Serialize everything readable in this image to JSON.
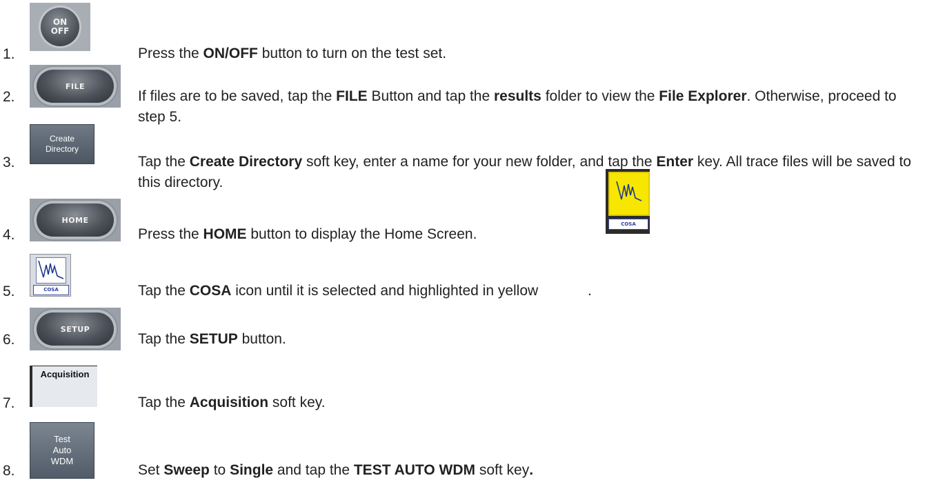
{
  "steps": [
    {
      "number": "1.",
      "icon": {
        "name": "onoff-button-icon",
        "lines": [
          "ON",
          "OFF"
        ]
      },
      "parts": [
        {
          "t": "Press the "
        },
        {
          "t": "ON/OFF",
          "b": true
        },
        {
          "t": " button to turn on the test set."
        }
      ]
    },
    {
      "number": "2.",
      "icon": {
        "name": "file-button-icon",
        "label": "FILE"
      },
      "parts": [
        {
          "t": "If files are to be saved, tap the "
        },
        {
          "t": "FILE",
          "b": true
        },
        {
          "t": " Button and tap the "
        },
        {
          "t": "results",
          "b": true
        },
        {
          "t": " folder to view the "
        },
        {
          "t": "File Explorer",
          "b": true
        },
        {
          "t": ".  Otherwise, proceed to step 5."
        }
      ]
    },
    {
      "number": "3.",
      "icon": {
        "name": "create-directory-softkey-icon",
        "lines": [
          "Create",
          "Directory"
        ]
      },
      "parts": [
        {
          "t": "Tap the "
        },
        {
          "t": "Create Directory",
          "b": true
        },
        {
          "t": " soft key, enter a name for your new folder, and tap the "
        },
        {
          "t": "Enter",
          "b": true
        },
        {
          "t": " key.  All trace files will be saved to this directory."
        }
      ]
    },
    {
      "number": "4.",
      "icon": {
        "name": "home-button-icon",
        "label": "HOME"
      },
      "parts": [
        {
          "t": "Press the "
        },
        {
          "t": "HOME",
          "b": true
        },
        {
          "t": " button to display the Home Screen."
        }
      ]
    },
    {
      "number": "5.",
      "icon": {
        "name": "cosa-icon",
        "label": "COSA"
      },
      "parts": [
        {
          "t": "Tap the "
        },
        {
          "t": "COSA",
          "b": true
        },
        {
          "t": " icon until it is selected and highlighted in yellow "
        },
        {
          "t": "."
        }
      ]
    },
    {
      "number": "6.",
      "icon": {
        "name": "setup-button-icon",
        "label": "SETUP"
      },
      "parts": [
        {
          "t": "Tap the "
        },
        {
          "t": "SETUP",
          "b": true
        },
        {
          "t": " button."
        }
      ]
    },
    {
      "number": "7.",
      "icon": {
        "name": "acquisition-softkey-icon",
        "label": "Acquisition"
      },
      "parts": [
        {
          "t": "Tap the "
        },
        {
          "t": "Acquisition",
          "b": true
        },
        {
          "t": " soft key."
        }
      ]
    },
    {
      "number": "8.",
      "icon": {
        "name": "test-auto-wdm-softkey-icon",
        "lines": [
          "Test",
          "Auto",
          "WDM"
        ]
      },
      "parts": [
        {
          "t": "Set "
        },
        {
          "t": "Sweep",
          "b": true
        },
        {
          "t": " to "
        },
        {
          "t": "Single",
          "b": true
        },
        {
          "t": " and tap the "
        },
        {
          "t": "TEST AUTO WDM",
          "b": true
        },
        {
          "t": " soft key"
        },
        {
          "t": ".",
          "b": true
        }
      ]
    }
  ],
  "cosa_selected": {
    "name": "cosa-selected-icon",
    "label": "COSA",
    "highlight": "#f7e600"
  }
}
